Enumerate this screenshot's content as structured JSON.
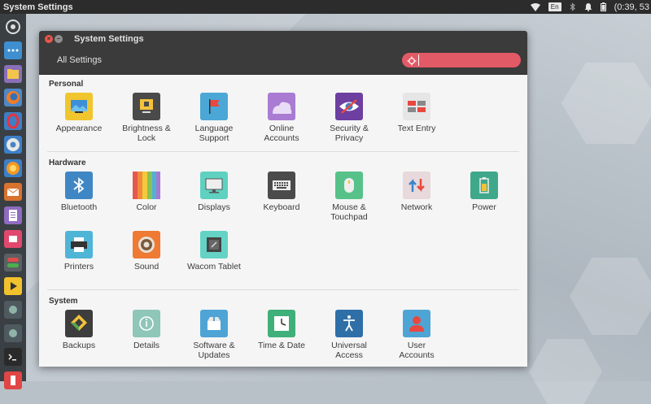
{
  "top_panel": {
    "title": "System Settings",
    "keyboard_layout": "En",
    "clock": "(0:39, 53"
  },
  "window": {
    "title": "System Settings",
    "toolbar": {
      "all_settings_label": "All Settings",
      "search_value": "",
      "search_placeholder": ""
    }
  },
  "sections": {
    "personal": {
      "title": "Personal",
      "items": [
        {
          "label": "Appearance",
          "icon": "appearance-icon"
        },
        {
          "label": "Brightness &\nLock",
          "icon": "brightness-lock-icon"
        },
        {
          "label": "Language\nSupport",
          "icon": "language-flag-icon"
        },
        {
          "label": "Online\nAccounts",
          "icon": "cloud-icon"
        },
        {
          "label": "Security &\nPrivacy",
          "icon": "eye-icon"
        },
        {
          "label": "Text Entry",
          "icon": "text-entry-icon"
        }
      ]
    },
    "hardware": {
      "title": "Hardware",
      "items": [
        {
          "label": "Bluetooth",
          "icon": "bluetooth-icon"
        },
        {
          "label": "Color",
          "icon": "color-icon"
        },
        {
          "label": "Displays",
          "icon": "monitor-icon"
        },
        {
          "label": "Keyboard",
          "icon": "keyboard-icon"
        },
        {
          "label": "Mouse &\nTouchpad",
          "icon": "mouse-icon"
        },
        {
          "label": "Network",
          "icon": "network-icon"
        },
        {
          "label": "Power",
          "icon": "battery-icon"
        },
        {
          "label": "Printers",
          "icon": "printer-icon"
        },
        {
          "label": "Sound",
          "icon": "speaker-icon"
        },
        {
          "label": "Wacom Tablet",
          "icon": "tablet-icon"
        }
      ]
    },
    "system": {
      "title": "System",
      "items": [
        {
          "label": "Backups",
          "icon": "backup-icon"
        },
        {
          "label": "Details",
          "icon": "info-icon"
        },
        {
          "label": "Software &\nUpdates",
          "icon": "software-box-icon"
        },
        {
          "label": "Time & Date",
          "icon": "clock-icon"
        },
        {
          "label": "Universal\nAccess",
          "icon": "accessibility-icon"
        },
        {
          "label": "User\nAccounts",
          "icon": "user-icon"
        }
      ]
    }
  },
  "colors": {
    "search_field": "#e25a66",
    "titlebar": "#3b3b3b",
    "close_button": "#e9584a"
  }
}
